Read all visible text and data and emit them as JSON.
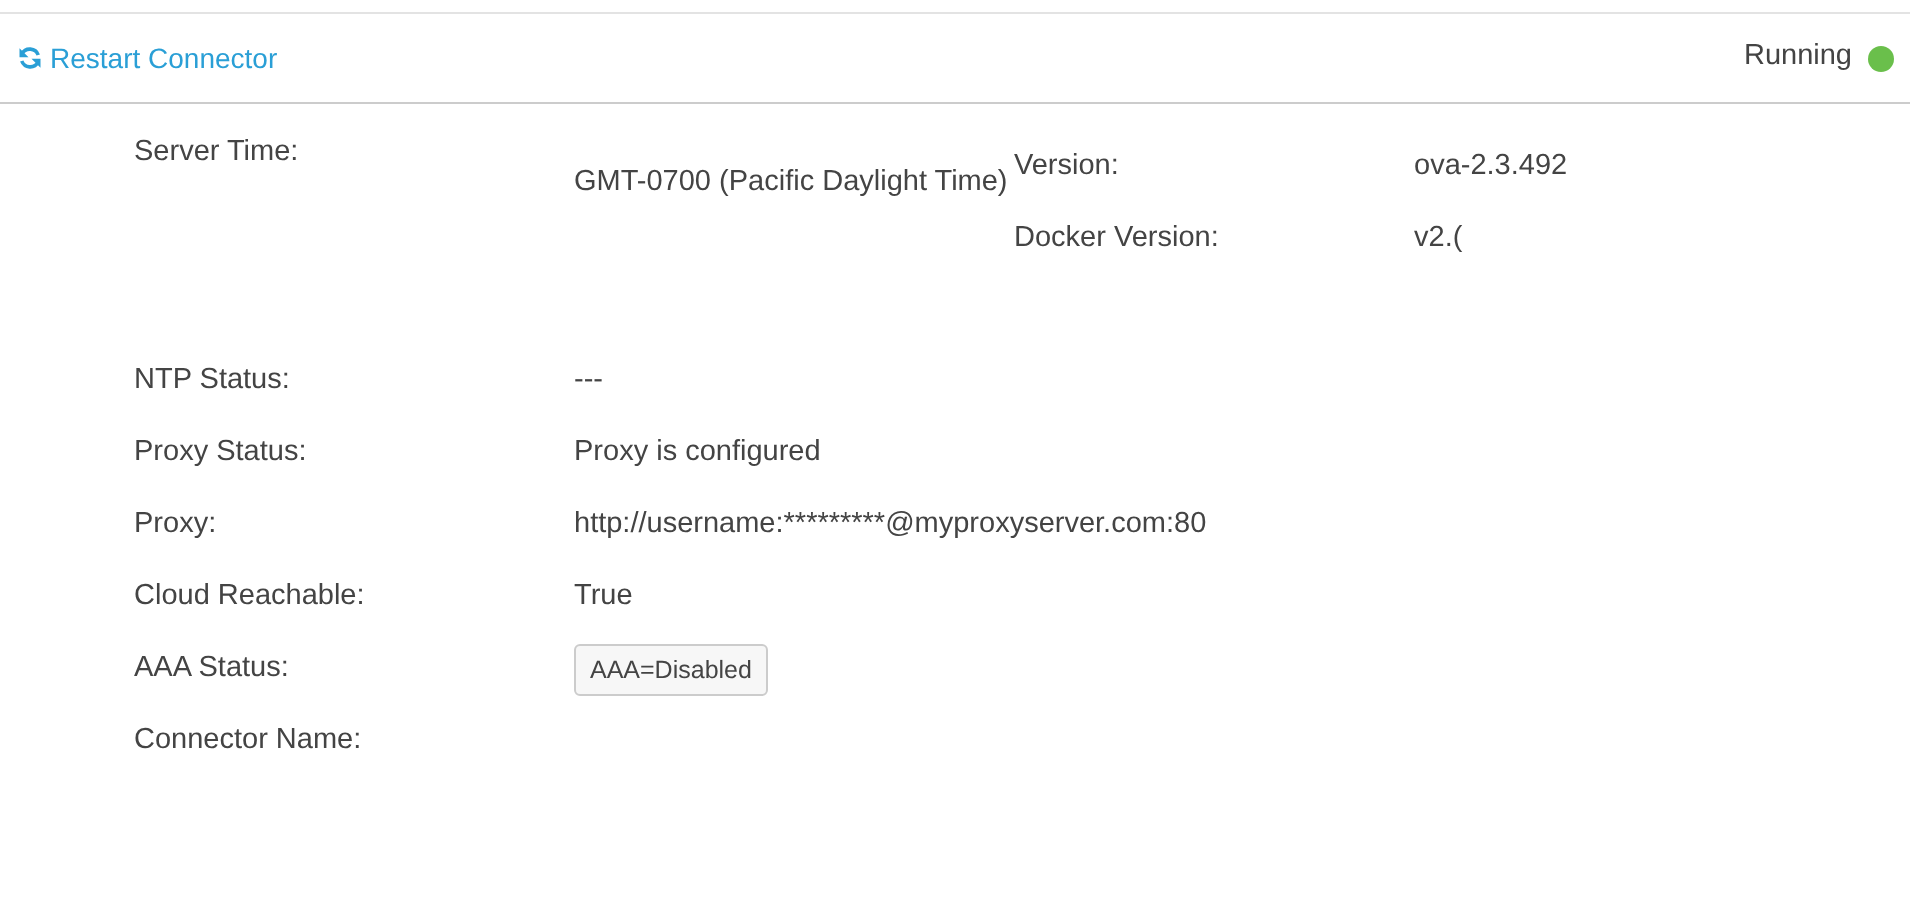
{
  "toolbar": {
    "restart_button": "Restart Connector",
    "status": {
      "label": "Running",
      "color": "#6abf4b"
    }
  },
  "server_time": {
    "label": "Server Time:",
    "value": "GMT-0700 (Pacific Daylight Time)"
  },
  "versions": [
    {
      "label": "Version:",
      "value": "ova-2.3.492"
    },
    {
      "label": "Docker Version:",
      "value": "v2.("
    }
  ],
  "fields": [
    {
      "kind": "text",
      "label": "NTP Status:",
      "value": "---"
    },
    {
      "kind": "text",
      "label": "Proxy Status:",
      "value": "Proxy is configured"
    },
    {
      "kind": "text",
      "label": "Proxy:",
      "value": "http://username:*********@myproxyserver.com:80"
    },
    {
      "kind": "text",
      "label": "Cloud Reachable:",
      "value": "True"
    },
    {
      "kind": "tag",
      "label": "AAA Status:",
      "value": "AAA=Disabled"
    },
    {
      "kind": "empty",
      "label": "Connector Name:"
    }
  ]
}
